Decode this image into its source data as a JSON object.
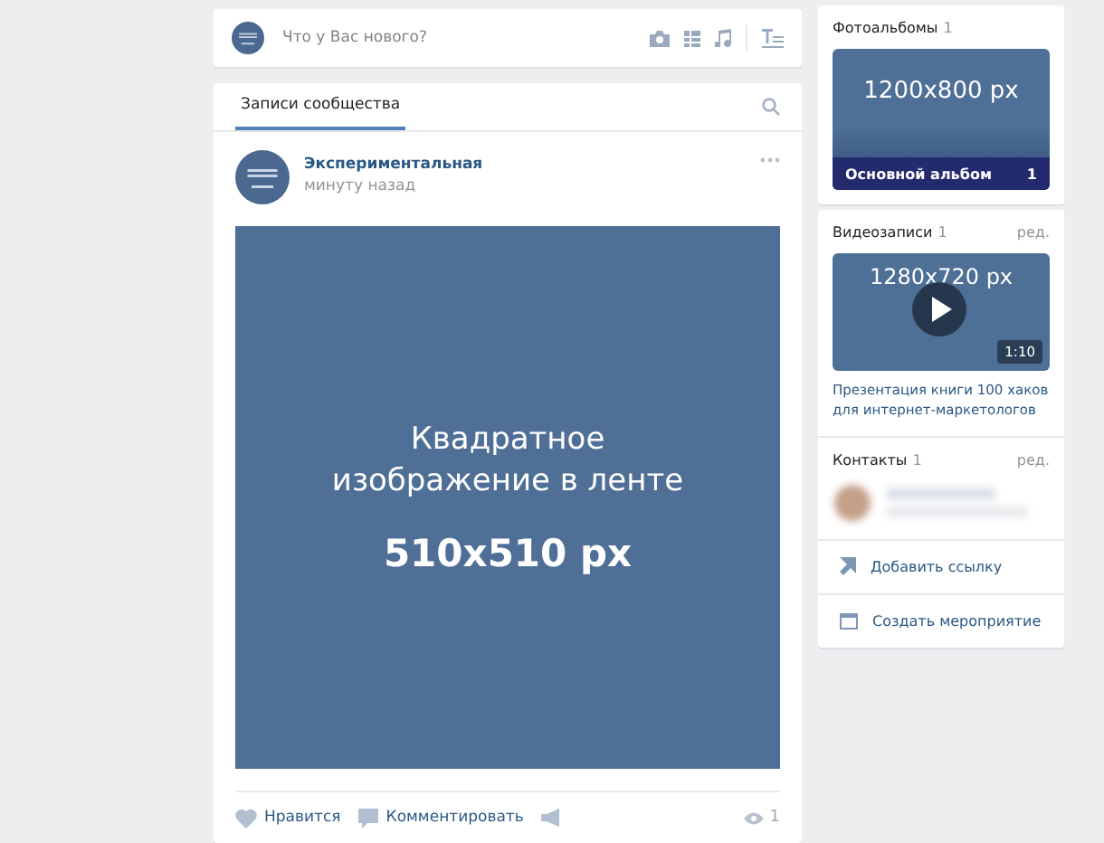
{
  "composer": {
    "placeholder": "Что у Вас нового?"
  },
  "wall": {
    "tabs": [
      {
        "label": "Записи сообщества",
        "selected": true
      }
    ],
    "post": {
      "author": "Экспериментальная",
      "time": "минуту назад",
      "image_lines": [
        "Квадратное",
        "изображение в ленте"
      ],
      "image_size": "510x510 px",
      "actions": [
        {
          "kind": "like",
          "label": "Нравится"
        },
        {
          "kind": "comment",
          "label": "Комментировать"
        },
        {
          "kind": "share"
        }
      ],
      "views": "1"
    }
  },
  "albums": {
    "title": "Фотоальбомы",
    "count": "1",
    "cover_text": "1200x800 px",
    "album_name": "Основной альбом",
    "album_count": "1"
  },
  "videos": {
    "title": "Видеозаписи",
    "count": "1",
    "edit": "ред.",
    "cover_text": "1280x720 px",
    "duration": "1:10",
    "caption": "Презентация книги 100 хаков для интернет-маркетологов"
  },
  "contacts": {
    "title": "Контакты",
    "count": "1",
    "edit": "ред."
  },
  "links": [
    {
      "kind": "link",
      "label": "Добавить ссылку"
    },
    {
      "kind": "event",
      "label": "Создать мероприятие"
    }
  ]
}
